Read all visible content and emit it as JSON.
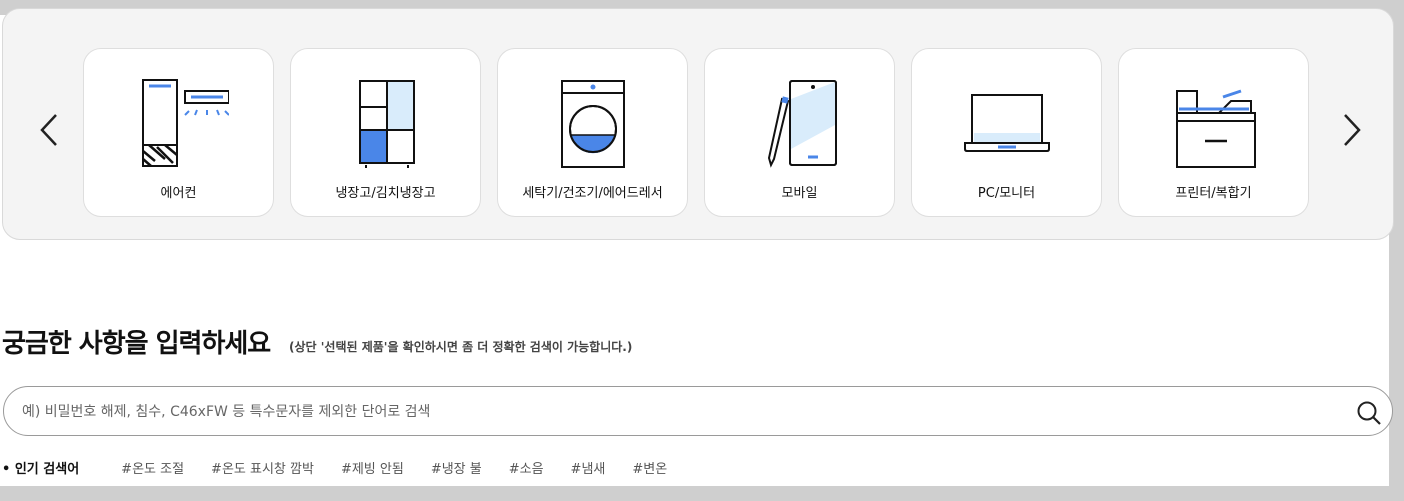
{
  "categories": [
    {
      "label": "에어컨",
      "icon": "air-conditioner-icon"
    },
    {
      "label": "냉장고/김치냉장고",
      "icon": "refrigerator-icon"
    },
    {
      "label": "세탁기/건조기/에어드레서",
      "icon": "washing-machine-icon"
    },
    {
      "label": "모바일",
      "icon": "mobile-phone-icon"
    },
    {
      "label": "PC/모니터",
      "icon": "laptop-icon"
    },
    {
      "label": "프린터/복합기",
      "icon": "printer-icon"
    }
  ],
  "nav": {
    "prev_icon": "chevron-left-icon",
    "next_icon": "chevron-right-icon"
  },
  "search": {
    "title": "궁금한 사항을 입력하세요",
    "hint": "(상단 '선택된 제품'을 확인하시면 좀 더 정확한 검색이 가능합니다.)",
    "placeholder": "예) 비밀번호 해제, 침수, C46xFW 등 특수문자를 제외한 단어로 검색",
    "button_icon": "search-icon"
  },
  "popular": {
    "title": "• 인기 검색어",
    "tags": [
      "#온도 조절",
      "#온도 표시창 깜박",
      "#제빙 안됨",
      "#냉장 불",
      "#소음",
      "#냄새",
      "#변온"
    ]
  },
  "colors": {
    "accent": "#4a86e8",
    "light_accent": "#d9ecfb",
    "panel_bg": "#f4f4f4"
  }
}
